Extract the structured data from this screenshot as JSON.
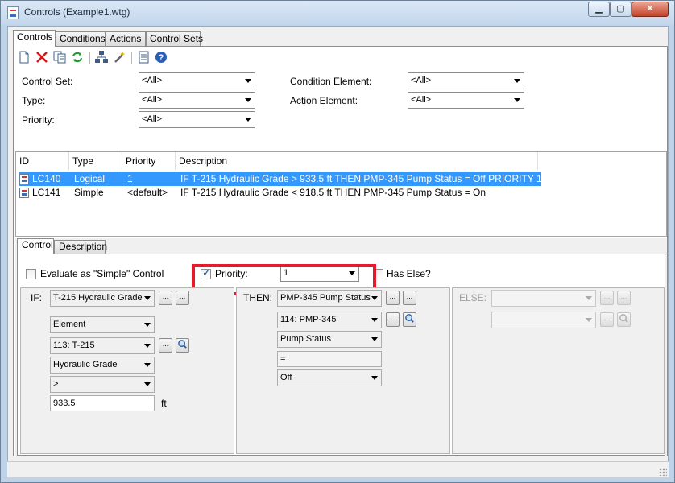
{
  "window": {
    "title": "Controls (Example1.wtg)"
  },
  "tabs": [
    "Controls",
    "Conditions",
    "Actions",
    "Control Sets"
  ],
  "filters": {
    "control_set": {
      "label": "Control Set:",
      "value": "<All>"
    },
    "type": {
      "label": "Type:",
      "value": "<All>"
    },
    "priority": {
      "label": "Priority:",
      "value": "<All>"
    },
    "condition_element": {
      "label": "Condition Element:",
      "value": "<All>"
    },
    "action_element": {
      "label": "Action Element:",
      "value": "<All>"
    }
  },
  "list": {
    "headers": [
      "ID",
      "Type",
      "Priority",
      "Description"
    ],
    "rows": [
      {
        "id": "LC140",
        "type": "Logical",
        "priority": "1",
        "description": "IF T-215 Hydraulic Grade > 933.5 ft THEN PMP-345 Pump Status = Off  PRIORITY 1",
        "selected": true
      },
      {
        "id": "LC141",
        "type": "Simple",
        "priority": "<default>",
        "description": "IF T-215 Hydraulic Grade < 918.5 ft THEN PMP-345 Pump Status = On",
        "selected": false
      }
    ]
  },
  "subtabs": [
    "Control",
    "Description"
  ],
  "control": {
    "evaluate_simple_label": "Evaluate as \"Simple\" Control",
    "priority_label": "Priority:",
    "priority_value": "1",
    "has_else_label": "Has Else?",
    "if": {
      "label": "IF:",
      "condition": "T-215 Hydraulic Grade",
      "category": "Element",
      "element": "113: T-215",
      "attribute": "Hydraulic Grade",
      "operator": ">",
      "value": "933.5",
      "unit": "ft"
    },
    "then": {
      "label": "THEN:",
      "action": "PMP-345 Pump Status",
      "element": "114: PMP-345",
      "attribute": "Pump Status",
      "operator": "=",
      "value": "Off"
    },
    "else": {
      "label": "ELSE:"
    }
  },
  "misc": {
    "ellipsis": "..."
  },
  "colors": {
    "selection": "#3399ff",
    "highlight": "#e8192a"
  }
}
